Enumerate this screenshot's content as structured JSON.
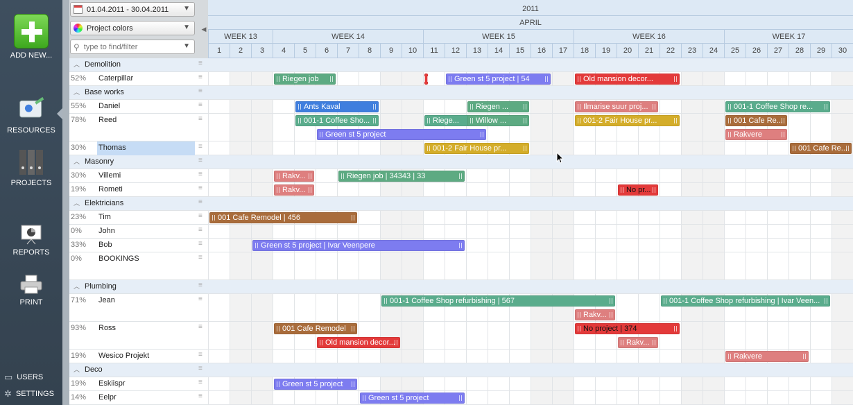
{
  "sidebar": {
    "add_new": "ADD NEW...",
    "resources": "RESOURCES",
    "projects": "PROJECTS",
    "reports": "REPORTS",
    "print": "PRINT",
    "users": "USERS",
    "settings": "SETTINGS"
  },
  "controls": {
    "date_range": "01.04.2011 - 30.04.2011",
    "color_mode": "Project colors",
    "filter_placeholder": "type to find/filter"
  },
  "header": {
    "year": "2011",
    "month": "APRIL",
    "weeks": [
      "WEEK 13",
      "WEEK 14",
      "WEEK 15",
      "WEEK 16",
      "WEEK 17"
    ],
    "days": [
      "1",
      "2",
      "3",
      "4",
      "5",
      "6",
      "7",
      "8",
      "9",
      "10",
      "11",
      "12",
      "13",
      "14",
      "15",
      "16",
      "17",
      "18",
      "19",
      "20",
      "21",
      "22",
      "23",
      "24",
      "25",
      "26",
      "27",
      "28",
      "29",
      "30"
    ]
  },
  "colors": {
    "green": "#5daa82",
    "blue": "#3f7ede",
    "purple": "#7d7cf0",
    "red": "#e33a3a",
    "pink": "#de7f7f",
    "yellow": "#d4ad2a",
    "brown": "#a96c3b",
    "teal": "#5aac8c"
  },
  "rows": [
    {
      "type": "group",
      "name": "Demolition"
    },
    {
      "type": "res",
      "pct": "52%",
      "name": "Caterpillar"
    },
    {
      "type": "group",
      "name": "Base works"
    },
    {
      "type": "res",
      "pct": "55%",
      "name": "Daniel"
    },
    {
      "type": "res",
      "pct": "78%",
      "name": "Reed",
      "lines": 2
    },
    {
      "type": "res",
      "pct": "30%",
      "name": "Thomas",
      "selected": true
    },
    {
      "type": "group",
      "name": "Masonry"
    },
    {
      "type": "res",
      "pct": "30%",
      "name": "Villemi"
    },
    {
      "type": "res",
      "pct": "19%",
      "name": "Rometi"
    },
    {
      "type": "group",
      "name": "Elektricians"
    },
    {
      "type": "res",
      "pct": "23%",
      "name": "Tim"
    },
    {
      "type": "res",
      "pct": "0%",
      "name": "John"
    },
    {
      "type": "res",
      "pct": "33%",
      "name": "Bob"
    },
    {
      "type": "res",
      "pct": "0%",
      "name": "BOOKINGS",
      "lines": 2
    },
    {
      "type": "group",
      "name": "Plumbing"
    },
    {
      "type": "res",
      "pct": "71%",
      "name": "Jean",
      "lines": 2
    },
    {
      "type": "res",
      "pct": "93%",
      "name": "Ross",
      "lines": 2
    },
    {
      "type": "res",
      "pct": "19%",
      "name": "Wesico Projekt"
    },
    {
      "type": "group",
      "name": "Deco"
    },
    {
      "type": "res",
      "pct": "19%",
      "name": "Eskiispr"
    },
    {
      "type": "res",
      "pct": "14%",
      "name": "Eelpr"
    }
  ],
  "bars": [
    {
      "row": 1,
      "line": 0,
      "start": 4,
      "end": 6,
      "label": "Riegen job",
      "color": "green"
    },
    {
      "row": 1,
      "line": 0,
      "start": 11,
      "end": 11,
      "label": "",
      "color": "red"
    },
    {
      "row": 1,
      "line": 0,
      "start": 12,
      "end": 16,
      "label": "Green st 5 project | 54",
      "color": "purple"
    },
    {
      "row": 1,
      "line": 0,
      "start": 18,
      "end": 22,
      "label": "Old mansion decor...",
      "color": "red"
    },
    {
      "row": 3,
      "line": 0,
      "start": 5,
      "end": 8,
      "label": "Ants Kaval",
      "color": "blue"
    },
    {
      "row": 3,
      "line": 0,
      "start": 13,
      "end": 15,
      "label": "Riegen ...",
      "color": "green"
    },
    {
      "row": 3,
      "line": 0,
      "start": 18,
      "end": 21,
      "label": "Ilmarise suur proj...",
      "color": "pink"
    },
    {
      "row": 3,
      "line": 0,
      "start": 25,
      "end": 29,
      "label": "001-1 Coffee Shop re...",
      "color": "teal"
    },
    {
      "row": 4,
      "line": 0,
      "start": 5,
      "end": 8,
      "label": "001-1 Coffee Sho...",
      "color": "teal"
    },
    {
      "row": 4,
      "line": 0,
      "start": 11,
      "end": 13,
      "label": "Riege...",
      "color": "teal"
    },
    {
      "row": 4,
      "line": 0,
      "start": 13,
      "end": 15,
      "label": "Willow ...",
      "color": "green"
    },
    {
      "row": 4,
      "line": 0,
      "start": 18,
      "end": 22,
      "label": "001-2 Fair House pr...",
      "color": "yellow"
    },
    {
      "row": 4,
      "line": 0,
      "start": 25,
      "end": 27,
      "label": "001 Cafe Re...",
      "color": "brown"
    },
    {
      "row": 4,
      "line": 1,
      "start": 6,
      "end": 13,
      "label": "Green st 5 project",
      "color": "purple"
    },
    {
      "row": 4,
      "line": 1,
      "start": 25,
      "end": 27,
      "label": "Rakvere",
      "color": "pink"
    },
    {
      "row": 5,
      "line": 0,
      "start": 11,
      "end": 15,
      "label": "001-2 Fair House pr...",
      "color": "yellow"
    },
    {
      "row": 5,
      "line": 0,
      "start": 28,
      "end": 30,
      "label": "001 Cafe Re...",
      "color": "brown"
    },
    {
      "row": 7,
      "line": 0,
      "start": 4,
      "end": 5,
      "label": "Rakv...",
      "color": "pink"
    },
    {
      "row": 7,
      "line": 0,
      "start": 7,
      "end": 12,
      "label": "Riegen job | 34343 | 33",
      "color": "green"
    },
    {
      "row": 8,
      "line": 0,
      "start": 4,
      "end": 5,
      "label": "Rakv...",
      "color": "pink"
    },
    {
      "row": 8,
      "line": 0,
      "start": 20,
      "end": 21,
      "label": "No pr...",
      "color": "red"
    },
    {
      "row": 10,
      "line": 0,
      "start": 1,
      "end": 7,
      "label": "001 Cafe Remodel | 456",
      "color": "brown"
    },
    {
      "row": 12,
      "line": 0,
      "start": 3,
      "end": 12,
      "label": "Green st 5 project | Ivar Veenpere",
      "color": "purple"
    },
    {
      "row": 15,
      "line": 0,
      "start": 9,
      "end": 19,
      "label": "001-1 Coffee Shop refurbishing | 567",
      "color": "teal"
    },
    {
      "row": 15,
      "line": 0,
      "start": 22,
      "end": 29,
      "label": "001-1 Coffee Shop refurbishing | Ivar Veen...",
      "color": "teal"
    },
    {
      "row": 15,
      "line": 1,
      "start": 18,
      "end": 19,
      "label": "Rakv...",
      "color": "pink"
    },
    {
      "row": 16,
      "line": 0,
      "start": 4,
      "end": 7,
      "label": "001 Cafe Remodel",
      "color": "brown"
    },
    {
      "row": 16,
      "line": 0,
      "start": 18,
      "end": 22,
      "label": "No project | 374",
      "color": "red"
    },
    {
      "row": 16,
      "line": 1,
      "start": 6,
      "end": 9,
      "label": "Old mansion decor...",
      "color": "red"
    },
    {
      "row": 16,
      "line": 1,
      "start": 20,
      "end": 21,
      "label": "Rakv...",
      "color": "pink"
    },
    {
      "row": 17,
      "line": 0,
      "start": 25,
      "end": 28,
      "label": "Rakvere",
      "color": "pink"
    },
    {
      "row": 19,
      "line": 0,
      "start": 4,
      "end": 7,
      "label": "Green st 5 project",
      "color": "purple"
    },
    {
      "row": 20,
      "line": 0,
      "start": 8,
      "end": 12,
      "label": "Green st 5 project",
      "color": "purple"
    }
  ]
}
